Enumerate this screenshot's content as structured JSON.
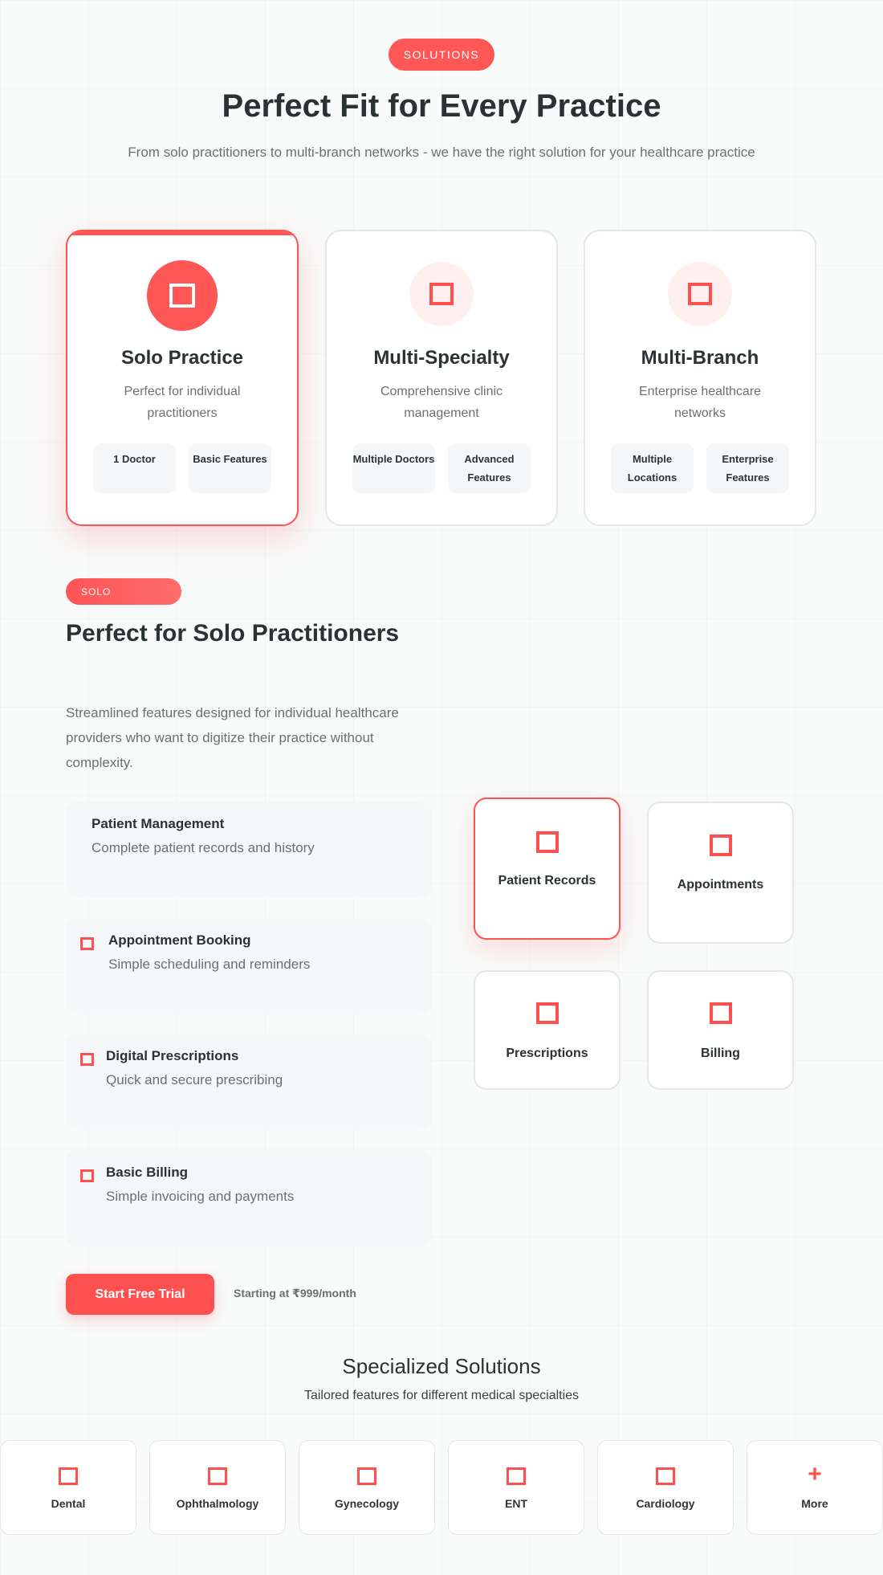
{
  "header": {
    "pill": "SOLUTIONS",
    "title": "Perfect Fit for Every Practice",
    "subtitle": "From solo practitioners to multi-branch networks - we have the right solution for your healthcare practice"
  },
  "cards": [
    {
      "icon": "square-icon",
      "title": "Solo Practice",
      "desc": "Perfect for individual practitioners",
      "chips": [
        "1 Doctor",
        "Basic Features"
      ]
    },
    {
      "icon": "square-icon",
      "title": "Multi-Specialty",
      "desc": "Comprehensive clinic management",
      "chips": [
        "Multiple Doctors",
        "Advanced Features"
      ]
    },
    {
      "icon": "square-icon",
      "title": "Multi-Branch",
      "desc": "Enterprise healthcare networks",
      "chips": [
        "Multiple Locations",
        "Enterprise Features"
      ]
    }
  ],
  "solo": {
    "pill": "SOLO",
    "title": "Perfect for Solo Practitioners",
    "desc": "Streamlined features designed for individual healthcare providers who want to digitize their practice without complexity.",
    "features": [
      {
        "title": "Patient Management",
        "desc": "Complete patient records and history",
        "icon": "none"
      },
      {
        "title": "Appointment Booking",
        "desc": "Simple scheduling and reminders",
        "icon": "square-icon"
      },
      {
        "title": "Digital Prescriptions",
        "desc": "Quick and secure prescribing",
        "icon": "square-icon"
      },
      {
        "title": "Basic Billing",
        "desc": "Simple invoicing and payments",
        "icon": "square-icon"
      }
    ],
    "tiles": [
      {
        "label": "Patient Records",
        "icon": "square-icon"
      },
      {
        "label": "Appointments",
        "icon": "square-icon"
      },
      {
        "label": "Prescriptions",
        "icon": "square-icon"
      },
      {
        "label": "Billing",
        "icon": "square-icon"
      }
    ],
    "cta": "Start Free Trial",
    "price": "Starting at ₹999/month"
  },
  "specialized": {
    "title": "Specialized Solutions",
    "subtitle": "Tailored features for different medical specialties",
    "items": [
      {
        "label": "Dental",
        "icon": "square-icon"
      },
      {
        "label": "Ophthalmology",
        "icon": "square-icon"
      },
      {
        "label": "Gynecology",
        "icon": "square-icon"
      },
      {
        "label": "ENT",
        "icon": "square-icon"
      },
      {
        "label": "Cardiology",
        "icon": "square-icon"
      },
      {
        "label": "More",
        "icon": "plus-icon",
        "glyph": "+"
      }
    ]
  },
  "colors": {
    "accent": "#ff5656",
    "text": "#2b3233",
    "muted": "#6b7073"
  }
}
